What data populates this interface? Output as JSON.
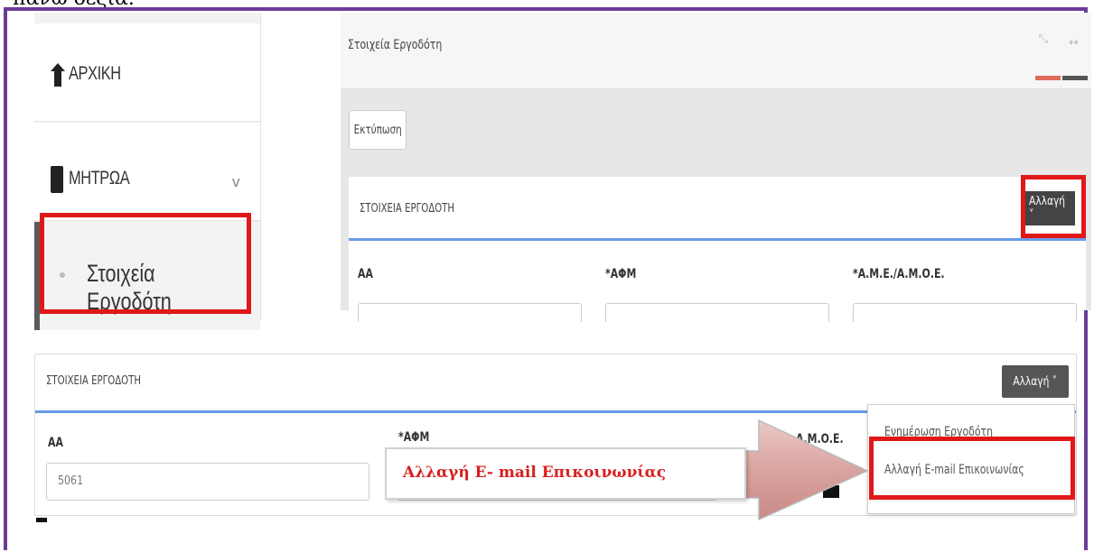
{
  "page": {
    "top_text": "πάνω δεξιά."
  },
  "sidebar": {
    "home_label": "ΑΡΧΙΚΗ",
    "registry_label": "ΜΗΤΡΩΑ",
    "registry_chevron": "v",
    "sub_item_label": "Στοιχεία Εργοδότη"
  },
  "panel_top": {
    "title": "Στοιχεία Εργοδότη",
    "print_label": "Εκτύπωση",
    "card_title": "ΣΤΟΙΧΕΙΑ ΕΡΓΟΔΟΤΗ",
    "change_label": "Αλλαγή ˅",
    "fields": [
      "ΑΑ",
      "*ΑΦΜ",
      "*Α.Μ.Ε./Α.Μ.Ο.Ε."
    ]
  },
  "panel_bottom": {
    "card_title": "ΣΤΟΙΧΕΙΑ ΕΡΓΟΔΟΤΗ",
    "change_label": "Αλλαγή ˅",
    "field_aa_label": "ΑΑ",
    "field_aa_value": "5061",
    "field_afm_label": "*ΑΦΜ",
    "field_ame_label": "Α.Μ.Ο.Ε."
  },
  "dropdown_menu": {
    "items": [
      "Ενημέρωση Εργοδότη",
      "Αλλαγή E-mail Επικοινωνίας"
    ]
  },
  "callout": {
    "text": "Αλλαγή E- mail Επικοινωνίας"
  },
  "colors": {
    "frame": "#6b3c98",
    "highlight": "#e01818",
    "callout_text": "#d71f1f",
    "accent_line": "#6a9be8",
    "arrow_fill": "#d9a3a0"
  }
}
